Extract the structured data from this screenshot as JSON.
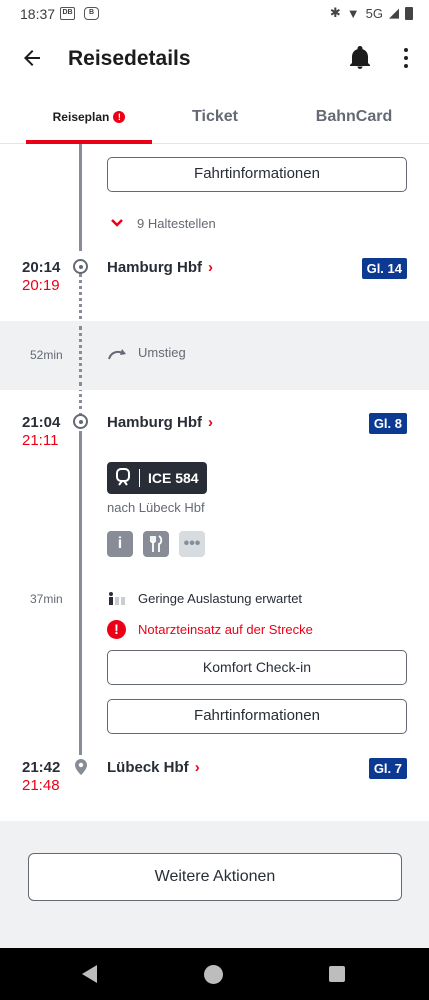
{
  "status_bar": {
    "time": "18:37",
    "network": "5G",
    "badge_1": "DB",
    "badge_2": "B"
  },
  "appbar": {
    "title": "Reisedetails",
    "back_icon": "arrow-left-icon",
    "bell_icon": "bell-icon",
    "menu_icon": "more-vertical-icon"
  },
  "tabs": [
    {
      "label": "Reiseplan",
      "active": true,
      "alert": "!"
    },
    {
      "label": "Ticket",
      "active": false
    },
    {
      "label": "BahnCard",
      "active": false
    }
  ],
  "journey": {
    "top_button": "Fahrtinformationen",
    "stops_toggle": "9 Haltestellen",
    "stop_1": {
      "planned": "20:14",
      "actual": "20:19",
      "station": "Hamburg Hbf",
      "track": "Gl. 14"
    },
    "transfer": {
      "duration": "52min",
      "label": "Umstieg"
    },
    "stop_2": {
      "planned": "21:04",
      "actual": "21:11",
      "station": "Hamburg Hbf",
      "track": "Gl. 8"
    },
    "train": {
      "name": "ICE 584",
      "direction": "nach Lübeck Hbf"
    },
    "amenities": [
      "info-icon",
      "restaurant-icon",
      "more-icon"
    ],
    "ride_duration": "37min",
    "occupancy": "Geringe Auslastung erwartet",
    "warning": "Notarzteinsatz auf der Strecke",
    "checkin_button": "Komfort Check-in",
    "info_button": "Fahrtinformationen",
    "stop_3": {
      "planned": "21:42",
      "actual": "21:48",
      "station": "Lübeck Hbf",
      "track": "Gl. 7"
    },
    "more_actions": "Weitere Aktionen"
  },
  "colors": {
    "red": "#ec0016",
    "track_blue": "#0c3992",
    "dark": "#282d37",
    "gray_band": "#f0f1f2"
  }
}
